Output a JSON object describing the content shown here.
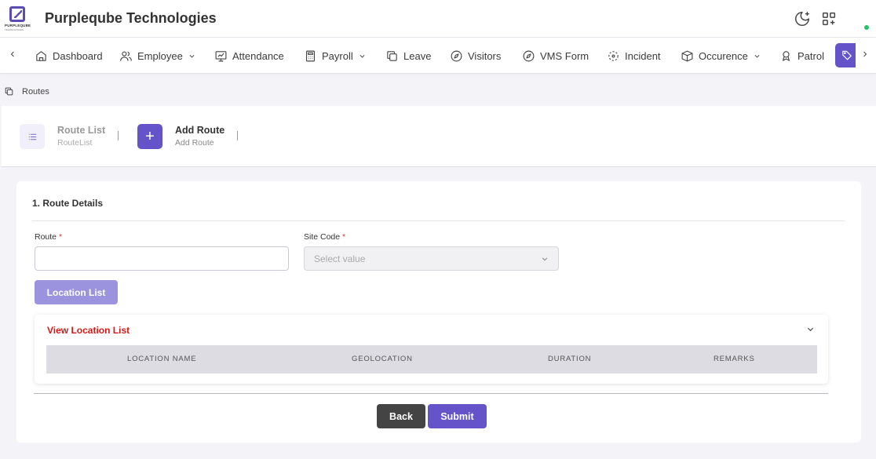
{
  "header": {
    "logo_text": "PURPLEQUBE",
    "logo_subtext": "TECHNOLOGIES",
    "company": "Purpleqube Technologies"
  },
  "nav": {
    "items": [
      {
        "label": "Dashboard",
        "icon": "home-icon"
      },
      {
        "label": "Employee",
        "icon": "users-icon",
        "dropdown": true
      },
      {
        "label": "Attendance",
        "icon": "chart-monitor-icon"
      },
      {
        "label": "Payroll",
        "icon": "calculator-icon",
        "dropdown": true
      },
      {
        "label": "Leave",
        "icon": "copy-icon"
      },
      {
        "label": "Visitors",
        "icon": "compass-icon"
      },
      {
        "label": "VMS Form",
        "icon": "compass-icon"
      },
      {
        "label": "Incident",
        "icon": "scan-icon"
      },
      {
        "label": "Occurence",
        "icon": "boxes-icon",
        "dropdown": true
      },
      {
        "label": "Patrol",
        "icon": "award-icon"
      }
    ],
    "active_color": "#6453c9"
  },
  "breadcrumb": {
    "label": "Routes"
  },
  "tabs": [
    {
      "title": "Route List",
      "subtitle": "RouteList"
    },
    {
      "title": "Add Route",
      "subtitle": "Add Route",
      "icon_text": "+"
    }
  ],
  "form": {
    "section_title": "1. Route Details",
    "route_label": "Route",
    "route_value": "",
    "site_code_label": "Site Code",
    "site_code_placeholder": "Select value",
    "required_mark": "*",
    "location_list_button": "Location List",
    "view_location_title": "View Location List",
    "columns": [
      "LOCATION NAME",
      "GEOLOCATION",
      "DURATION",
      "REMARKS"
    ],
    "back_button": "Back",
    "submit_button": "Submit"
  },
  "colors": {
    "primary": "#6453c9",
    "primary_light": "#9b93dd",
    "danger": "#d11a1a",
    "online": "#27c26c"
  }
}
